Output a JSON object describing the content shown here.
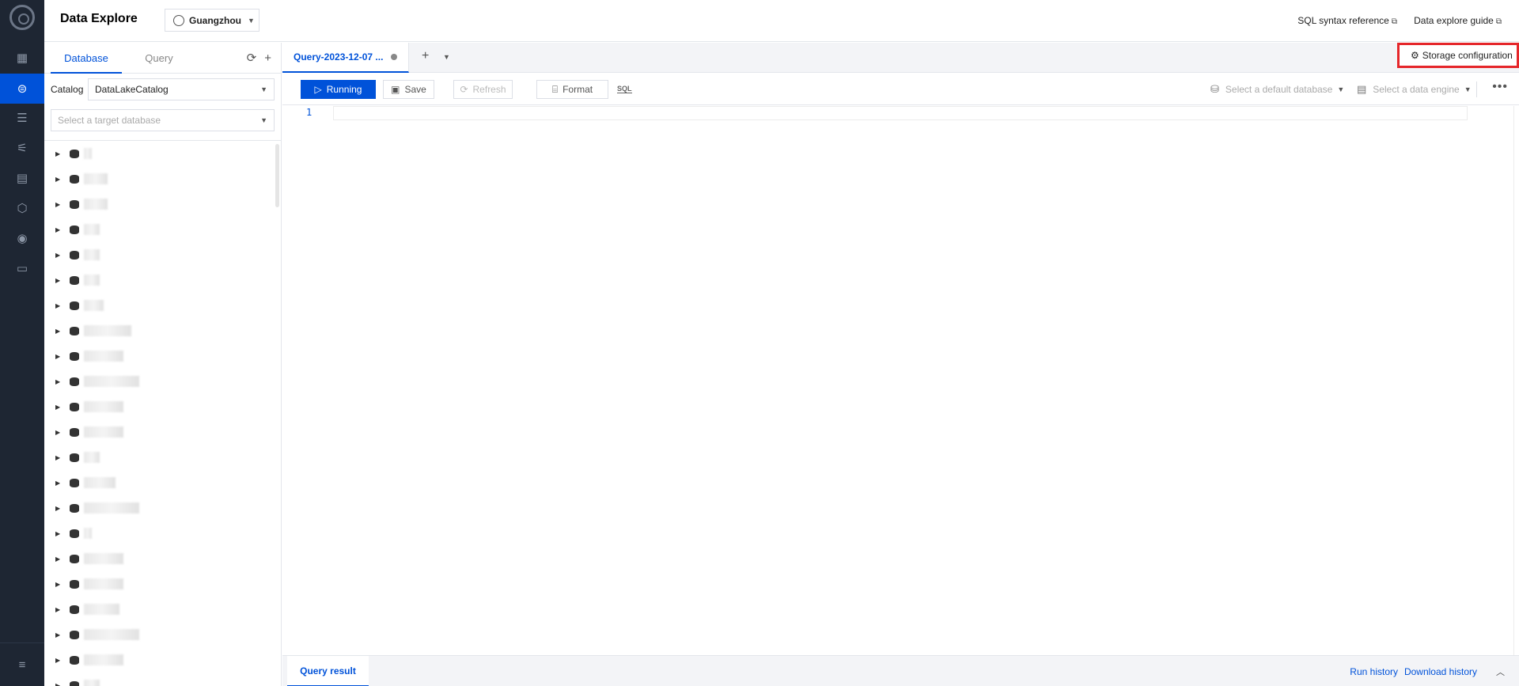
{
  "header": {
    "title": "Data Explore",
    "region": "Guangzhou",
    "links": [
      "SQL syntax reference",
      "Data explore guide"
    ]
  },
  "rail": {
    "icons": [
      "logo-icon",
      "dashboard-icon",
      "data-explore-icon",
      "list-icon",
      "sliders-icon",
      "document-icon",
      "cube-icon",
      "user-circle-icon",
      "monitor-icon",
      "menu-collapse-icon"
    ],
    "active": "data-explore-icon"
  },
  "left_panel": {
    "tabs": [
      "Database",
      "Query"
    ],
    "active_tab": "Database",
    "catalog_label": "Catalog",
    "catalog_value": "DataLakeCatalog",
    "database_placeholder": "Select a target database",
    "database_count_visible": 22
  },
  "query_tab": {
    "label": "Query-2023-12-07 ..."
  },
  "storage_button": "Storage configuration",
  "toolbar": {
    "run": "Running",
    "save": "Save",
    "refresh": "Refresh",
    "format": "Format",
    "sql_icon_text": "SQL",
    "default_database_placeholder": "Select a default database",
    "data_engine_placeholder": "Select a data engine"
  },
  "editor": {
    "line_number": "1"
  },
  "bottom": {
    "tab": "Query result",
    "run_history": "Run history",
    "download_history": "Download history"
  },
  "colors": {
    "accent": "#0052d9",
    "rail_bg": "#1e2633",
    "highlight_box": "#e5262a"
  }
}
